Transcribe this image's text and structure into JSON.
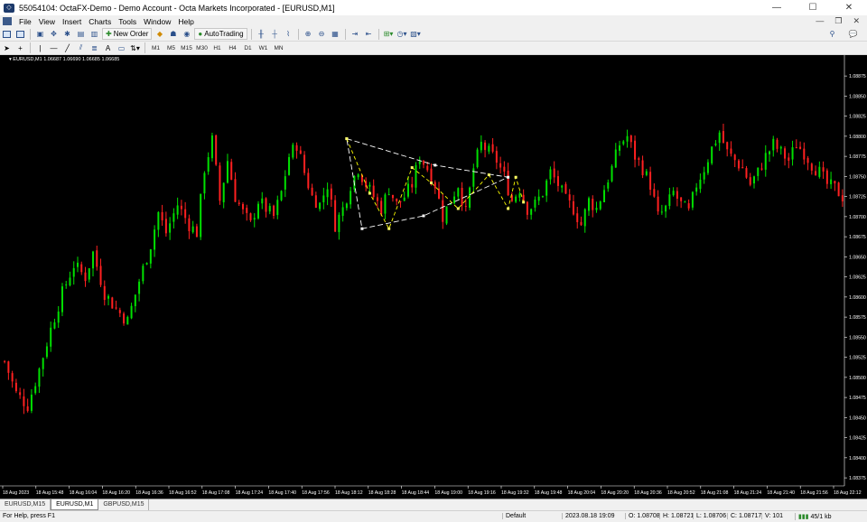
{
  "window": {
    "title": "55054104: OctaFX-Demo - Demo Account - Octa Markets Incorporated - [EURUSD,M1]",
    "icon": "mt4-app-icon"
  },
  "menu": {
    "items": [
      "File",
      "View",
      "Insert",
      "Charts",
      "Tools",
      "Window",
      "Help"
    ]
  },
  "toolbar": {
    "new_order_label": "New Order",
    "autotrading_label": "AutoTrading",
    "timeframes": [
      "M1",
      "M5",
      "M15",
      "M30",
      "H1",
      "H4",
      "D1",
      "W1",
      "MN"
    ]
  },
  "chart": {
    "symbol_label": "EURUSD,M1  1.06687 1.06690 1.06685 1.06685",
    "background": "#000000",
    "bull_color": "#00e000",
    "bear_color": "#ff2020"
  },
  "chart_data": {
    "type": "candlestick",
    "y_ticks": [
      "1.08875",
      "1.08850",
      "1.08825",
      "1.08800",
      "1.08775",
      "1.08750",
      "1.08725",
      "1.08700",
      "1.08675",
      "1.08650",
      "1.08625",
      "1.08600",
      "1.08575",
      "1.08550",
      "1.08525",
      "1.08500",
      "1.08475",
      "1.08450",
      "1.08425",
      "1.08400",
      "1.08375"
    ],
    "ylim": [
      1.08365,
      1.08892
    ],
    "x_ticks": [
      "18 Aug 2023",
      "18 Aug 15:48",
      "18 Aug 16:04",
      "18 Aug 16:20",
      "18 Aug 16:36",
      "18 Aug 16:52",
      "18 Aug 17:08",
      "18 Aug 17:24",
      "18 Aug 17:40",
      "18 Aug 17:56",
      "18 Aug 18:12",
      "18 Aug 18:28",
      "18 Aug 18:44",
      "18 Aug 19:00",
      "18 Aug 19:16",
      "18 Aug 19:32",
      "18 Aug 19:48",
      "18 Aug 20:04",
      "18 Aug 20:20",
      "18 Aug 20:36",
      "18 Aug 20:52",
      "18 Aug 21:08",
      "18 Aug 21:24",
      "18 Aug 21:40",
      "18 Aug 21:56",
      "18 Aug 22:12"
    ],
    "close_path": [
      [
        0,
        1.0852
      ],
      [
        3,
        1.0848
      ],
      [
        6,
        1.08465
      ],
      [
        9,
        1.0851
      ],
      [
        12,
        1.0856
      ],
      [
        15,
        1.08605
      ],
      [
        18,
        1.0864
      ],
      [
        21,
        1.08625
      ],
      [
        23,
        1.08655
      ],
      [
        26,
        1.08605
      ],
      [
        29,
        1.08585
      ],
      [
        32,
        1.0857
      ],
      [
        35,
        1.0862
      ],
      [
        38,
        1.08665
      ],
      [
        40,
        1.08705
      ],
      [
        42,
        1.0868
      ],
      [
        45,
        1.08715
      ],
      [
        48,
        1.0869
      ],
      [
        50,
        1.0868
      ],
      [
        52,
        1.0876
      ],
      [
        54,
        1.08795
      ],
      [
        56,
        1.0872
      ],
      [
        58,
        1.0877
      ],
      [
        60,
        1.08725
      ],
      [
        62,
        1.08705
      ],
      [
        64,
        1.0869
      ],
      [
        66,
        1.0872
      ],
      [
        68,
        1.0871
      ],
      [
        70,
        1.087
      ],
      [
        72,
        1.0873
      ],
      [
        74,
        1.08775
      ],
      [
        76,
        1.0879
      ],
      [
        78,
        1.08755
      ],
      [
        80,
        1.08725
      ],
      [
        82,
        1.08715
      ],
      [
        84,
        1.0874
      ],
      [
        86,
        1.0869
      ],
      [
        88,
        1.0871
      ],
      [
        90,
        1.0874
      ],
      [
        92,
        1.0876
      ],
      [
        94,
        1.0874
      ],
      [
        96,
        1.08725
      ],
      [
        98,
        1.0871
      ],
      [
        100,
        1.08735
      ],
      [
        102,
        1.08715
      ],
      [
        104,
        1.08725
      ],
      [
        106,
        1.0874
      ],
      [
        108,
        1.08775
      ],
      [
        110,
        1.0876
      ],
      [
        112,
        1.0874
      ],
      [
        114,
        1.087
      ],
      [
        116,
        1.0872
      ],
      [
        118,
        1.0874
      ],
      [
        120,
        1.08705
      ],
      [
        122,
        1.0876
      ],
      [
        124,
        1.0879
      ],
      [
        126,
        1.0878
      ],
      [
        128,
        1.0877
      ],
      [
        130,
        1.0875
      ],
      [
        132,
        1.0872
      ],
      [
        134,
        1.08735
      ],
      [
        136,
        1.0871
      ],
      [
        138,
        1.08715
      ],
      [
        140,
        1.0873
      ],
      [
        142,
        1.08755
      ],
      [
        144,
        1.0874
      ],
      [
        146,
        1.0872
      ],
      [
        148,
        1.0871
      ],
      [
        150,
        1.0869
      ],
      [
        152,
        1.0872
      ],
      [
        154,
        1.0871
      ],
      [
        156,
        1.08735
      ],
      [
        158,
        1.0876
      ],
      [
        160,
        1.0879
      ],
      [
        162,
        1.088
      ],
      [
        164,
        1.08775
      ],
      [
        166,
        1.0876
      ],
      [
        168,
        1.0874
      ],
      [
        170,
        1.087
      ],
      [
        172,
        1.0871
      ],
      [
        174,
        1.0873
      ],
      [
        176,
        1.08715
      ],
      [
        178,
        1.08705
      ],
      [
        180,
        1.0874
      ],
      [
        182,
        1.0876
      ],
      [
        184,
        1.08785
      ],
      [
        186,
        1.08805
      ],
      [
        188,
        1.0878
      ],
      [
        190,
        1.0877
      ],
      [
        192,
        1.0876
      ],
      [
        194,
        1.0874
      ],
      [
        196,
        1.08755
      ],
      [
        198,
        1.08775
      ],
      [
        200,
        1.0879
      ],
      [
        202,
        1.0878
      ],
      [
        204,
        1.0877
      ],
      [
        206,
        1.0879
      ],
      [
        208,
        1.0878
      ],
      [
        210,
        1.08765
      ],
      [
        212,
        1.08755
      ],
      [
        214,
        1.0874
      ],
      [
        216,
        1.08735
      ],
      [
        218,
        1.08725
      ]
    ],
    "candle_count": 219,
    "pattern_outline": [
      [
        89,
        1.08797
      ],
      [
        112,
        1.08764
      ],
      [
        131,
        1.08749
      ],
      [
        109,
        1.08701
      ],
      [
        93,
        1.08685
      ]
    ],
    "pattern_zigzag": [
      [
        89,
        1.08797
      ],
      [
        95,
        1.08729
      ],
      [
        100,
        1.08685
      ],
      [
        106,
        1.08761
      ],
      [
        111,
        1.08742
      ],
      [
        118,
        1.0871
      ],
      [
        126,
        1.08752
      ],
      [
        131,
        1.0871
      ],
      [
        133,
        1.08749
      ],
      [
        135,
        1.08718
      ]
    ]
  },
  "tabs": {
    "items": [
      "EURUSD,M15",
      "EURUSD,M1",
      "GBPUSD,M15"
    ],
    "active_index": 1
  },
  "status": {
    "help": "For Help, press F1",
    "profile": "Default",
    "datetime": "2023.08.18 19:09",
    "open": "O: 1.08708",
    "high": "H: 1.08721",
    "low": "L: 1.08706",
    "close": "C: 1.08717",
    "volume": "V: 101",
    "connection": "45/1 kb"
  }
}
